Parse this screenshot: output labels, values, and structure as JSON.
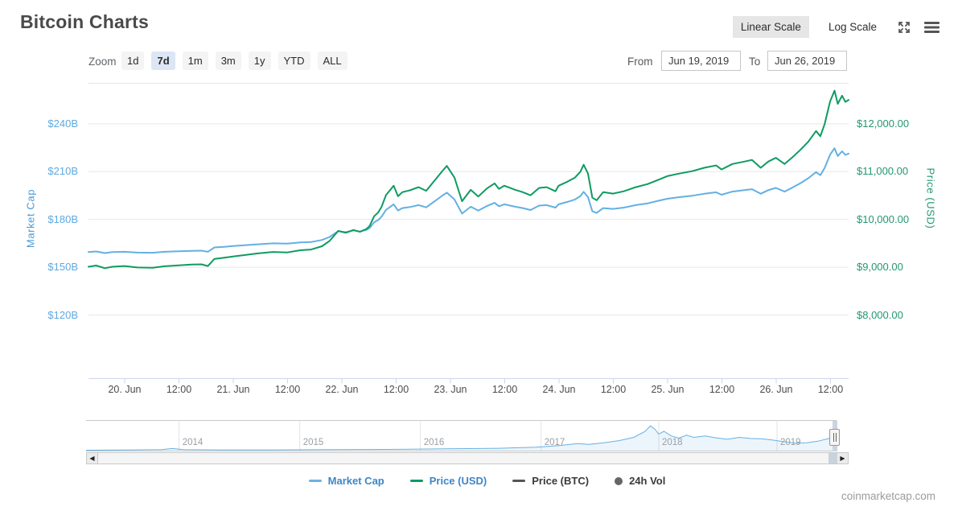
{
  "page": {
    "title": "Bitcoin Charts",
    "watermark": "coinmarketcap.com"
  },
  "scale_toggle": {
    "linear": "Linear Scale",
    "log": "Log Scale",
    "active": "Linear Scale"
  },
  "toolbar": {
    "zoom_label": "Zoom",
    "ranges": [
      "1d",
      "7d",
      "1m",
      "3m",
      "1y",
      "YTD",
      "ALL"
    ],
    "active_range": "7d",
    "from_label": "From",
    "from_value": "Jun 19, 2019",
    "to_label": "To",
    "to_value": "Jun 26, 2019"
  },
  "chart_data": {
    "type": "line",
    "title": "Bitcoin Charts",
    "x_axis": {
      "start": "Jun 19, 2019 16:00",
      "end": "Jun 26, 2019 16:00",
      "tick_labels": [
        "20. Jun",
        "12:00",
        "21. Jun",
        "12:00",
        "22. Jun",
        "12:00",
        "23. Jun",
        "12:00",
        "24. Jun",
        "12:00",
        "25. Jun",
        "12:00",
        "26. Jun",
        "12:00"
      ]
    },
    "left_axis": {
      "title": "Market Cap",
      "unit": "USD billions",
      "ticks": [
        "$240B",
        "$210B",
        "$180B",
        "$150B",
        "$120B"
      ],
      "values": [
        240,
        210,
        180,
        150,
        120
      ],
      "range": [
        120,
        240
      ]
    },
    "right_axis": {
      "title": "Price (USD)",
      "unit": "USD",
      "ticks": [
        "$12,000.00",
        "$11,000.00",
        "$10,000.00",
        "$9,000.00",
        "$8,000.00"
      ],
      "values": [
        12000,
        11000,
        10000,
        9000,
        8000
      ],
      "range": [
        8000,
        12000
      ]
    },
    "series": [
      {
        "name": "Market Cap",
        "axis": "left",
        "color": "#63b0e3",
        "unit": "$B",
        "points": [
          [
            0,
            159.5
          ],
          [
            0.07,
            159.9
          ],
          [
            0.15,
            158.9
          ],
          [
            0.22,
            159.5
          ],
          [
            0.33,
            159.7
          ],
          [
            0.45,
            159.2
          ],
          [
            0.59,
            159.1
          ],
          [
            0.7,
            159.7
          ],
          [
            0.83,
            160.0
          ],
          [
            0.95,
            160.3
          ],
          [
            1.04,
            160.4
          ],
          [
            1.1,
            159.7
          ],
          [
            1.16,
            162.4
          ],
          [
            1.25,
            162.8
          ],
          [
            1.33,
            163.3
          ],
          [
            1.45,
            163.9
          ],
          [
            1.56,
            164.4
          ],
          [
            1.7,
            165.0
          ],
          [
            1.83,
            164.8
          ],
          [
            1.95,
            165.6
          ],
          [
            2.05,
            165.8
          ],
          [
            2.15,
            167.1
          ],
          [
            2.22,
            169.0
          ],
          [
            2.3,
            172.7
          ],
          [
            2.37,
            172.0
          ],
          [
            2.44,
            173.1
          ],
          [
            2.5,
            172.4
          ],
          [
            2.56,
            173.5
          ],
          [
            2.59,
            174.6
          ],
          [
            2.63,
            178.2
          ],
          [
            2.67,
            179.7
          ],
          [
            2.7,
            181.8
          ],
          [
            2.74,
            186.0
          ],
          [
            2.78,
            188.0
          ],
          [
            2.81,
            189.5
          ],
          [
            2.85,
            185.6
          ],
          [
            2.89,
            187.1
          ],
          [
            2.96,
            187.8
          ],
          [
            3.04,
            189.0
          ],
          [
            3.11,
            187.6
          ],
          [
            3.19,
            191.5
          ],
          [
            3.26,
            195.0
          ],
          [
            3.3,
            196.8
          ],
          [
            3.37,
            192.5
          ],
          [
            3.44,
            183.7
          ],
          [
            3.52,
            188.0
          ],
          [
            3.59,
            185.5
          ],
          [
            3.67,
            188.5
          ],
          [
            3.74,
            190.4
          ],
          [
            3.78,
            188.3
          ],
          [
            3.83,
            189.5
          ],
          [
            3.93,
            188.0
          ],
          [
            4.0,
            187.1
          ],
          [
            4.07,
            185.9
          ],
          [
            4.15,
            188.7
          ],
          [
            4.22,
            189.0
          ],
          [
            4.3,
            187.4
          ],
          [
            4.33,
            189.5
          ],
          [
            4.41,
            191.0
          ],
          [
            4.48,
            192.5
          ],
          [
            4.53,
            194.7
          ],
          [
            4.56,
            197.3
          ],
          [
            4.6,
            194.0
          ],
          [
            4.64,
            185.1
          ],
          [
            4.68,
            184.1
          ],
          [
            4.74,
            187.1
          ],
          [
            4.83,
            186.6
          ],
          [
            4.93,
            187.4
          ],
          [
            5.04,
            189.0
          ],
          [
            5.15,
            190.1
          ],
          [
            5.26,
            191.9
          ],
          [
            5.33,
            193.0
          ],
          [
            5.44,
            194.0
          ],
          [
            5.56,
            194.9
          ],
          [
            5.67,
            196.1
          ],
          [
            5.78,
            197.0
          ],
          [
            5.83,
            195.5
          ],
          [
            5.93,
            197.5
          ],
          [
            6.04,
            198.4
          ],
          [
            6.11,
            199.0
          ],
          [
            6.19,
            196.1
          ],
          [
            6.26,
            198.4
          ],
          [
            6.33,
            199.8
          ],
          [
            6.41,
            197.5
          ],
          [
            6.48,
            199.9
          ],
          [
            6.56,
            202.9
          ],
          [
            6.63,
            205.9
          ],
          [
            6.7,
            209.7
          ],
          [
            6.74,
            207.8
          ],
          [
            6.78,
            212.4
          ],
          [
            6.83,
            220.7
          ],
          [
            6.87,
            224.7
          ],
          [
            6.9,
            219.8
          ],
          [
            6.94,
            222.8
          ],
          [
            6.97,
            220.5
          ],
          [
            7.0,
            221.3
          ]
        ]
      },
      {
        "name": "Price (USD)",
        "axis": "right",
        "color": "#0f9b62",
        "unit": "$",
        "points": [
          [
            0,
            9010
          ],
          [
            0.07,
            9035
          ],
          [
            0.15,
            8980
          ],
          [
            0.22,
            9010
          ],
          [
            0.33,
            9025
          ],
          [
            0.45,
            8995
          ],
          [
            0.59,
            8990
          ],
          [
            0.7,
            9020
          ],
          [
            0.83,
            9040
          ],
          [
            0.95,
            9055
          ],
          [
            1.04,
            9060
          ],
          [
            1.1,
            9025
          ],
          [
            1.16,
            9175
          ],
          [
            1.25,
            9200
          ],
          [
            1.33,
            9225
          ],
          [
            1.45,
            9260
          ],
          [
            1.56,
            9290
          ],
          [
            1.7,
            9320
          ],
          [
            1.83,
            9310
          ],
          [
            1.95,
            9355
          ],
          [
            2.05,
            9370
          ],
          [
            2.15,
            9440
          ],
          [
            2.22,
            9550
          ],
          [
            2.3,
            9760
          ],
          [
            2.37,
            9720
          ],
          [
            2.44,
            9780
          ],
          [
            2.5,
            9740
          ],
          [
            2.56,
            9800
          ],
          [
            2.59,
            9865
          ],
          [
            2.63,
            10065
          ],
          [
            2.67,
            10150
          ],
          [
            2.7,
            10270
          ],
          [
            2.74,
            10510
          ],
          [
            2.78,
            10620
          ],
          [
            2.81,
            10705
          ],
          [
            2.85,
            10485
          ],
          [
            2.89,
            10570
          ],
          [
            2.96,
            10610
          ],
          [
            3.04,
            10675
          ],
          [
            3.11,
            10600
          ],
          [
            3.19,
            10820
          ],
          [
            3.26,
            11015
          ],
          [
            3.3,
            11120
          ],
          [
            3.37,
            10875
          ],
          [
            3.44,
            10380
          ],
          [
            3.52,
            10620
          ],
          [
            3.59,
            10480
          ],
          [
            3.67,
            10650
          ],
          [
            3.74,
            10755
          ],
          [
            3.78,
            10640
          ],
          [
            3.83,
            10705
          ],
          [
            3.93,
            10620
          ],
          [
            4.0,
            10570
          ],
          [
            4.07,
            10505
          ],
          [
            4.15,
            10660
          ],
          [
            4.22,
            10675
          ],
          [
            4.3,
            10590
          ],
          [
            4.33,
            10705
          ],
          [
            4.41,
            10790
          ],
          [
            4.48,
            10875
          ],
          [
            4.53,
            11000
          ],
          [
            4.56,
            11145
          ],
          [
            4.6,
            10960
          ],
          [
            4.64,
            10455
          ],
          [
            4.68,
            10400
          ],
          [
            4.74,
            10570
          ],
          [
            4.83,
            10540
          ],
          [
            4.93,
            10590
          ],
          [
            5.04,
            10675
          ],
          [
            5.15,
            10740
          ],
          [
            5.26,
            10840
          ],
          [
            5.33,
            10905
          ],
          [
            5.44,
            10960
          ],
          [
            5.56,
            11010
          ],
          [
            5.67,
            11080
          ],
          [
            5.78,
            11130
          ],
          [
            5.83,
            11045
          ],
          [
            5.93,
            11160
          ],
          [
            6.04,
            11210
          ],
          [
            6.11,
            11245
          ],
          [
            6.19,
            11080
          ],
          [
            6.26,
            11210
          ],
          [
            6.33,
            11290
          ],
          [
            6.41,
            11160
          ],
          [
            6.48,
            11295
          ],
          [
            6.56,
            11465
          ],
          [
            6.63,
            11630
          ],
          [
            6.7,
            11850
          ],
          [
            6.74,
            11740
          ],
          [
            6.78,
            12000
          ],
          [
            6.83,
            12470
          ],
          [
            6.87,
            12695
          ],
          [
            6.9,
            12420
          ],
          [
            6.94,
            12590
          ],
          [
            6.97,
            12460
          ],
          [
            7.0,
            12500
          ]
        ]
      }
    ],
    "navigator": {
      "year_labels": [
        "2014",
        "2015",
        "2016",
        "2017",
        "2018",
        "2019"
      ],
      "series_name": "Market Cap (all time)",
      "points": [
        [
          0,
          0.03
        ],
        [
          0.06,
          0.04
        ],
        [
          0.1,
          0.05
        ],
        [
          0.115,
          0.09
        ],
        [
          0.13,
          0.05
        ],
        [
          0.18,
          0.04
        ],
        [
          0.25,
          0.04
        ],
        [
          0.32,
          0.05
        ],
        [
          0.4,
          0.06
        ],
        [
          0.48,
          0.08
        ],
        [
          0.55,
          0.1
        ],
        [
          0.6,
          0.14
        ],
        [
          0.63,
          0.2
        ],
        [
          0.655,
          0.27
        ],
        [
          0.67,
          0.24
        ],
        [
          0.69,
          0.3
        ],
        [
          0.71,
          0.38
        ],
        [
          0.73,
          0.5
        ],
        [
          0.745,
          0.72
        ],
        [
          0.752,
          0.92
        ],
        [
          0.758,
          0.8
        ],
        [
          0.763,
          0.62
        ],
        [
          0.77,
          0.72
        ],
        [
          0.78,
          0.55
        ],
        [
          0.79,
          0.47
        ],
        [
          0.8,
          0.58
        ],
        [
          0.81,
          0.5
        ],
        [
          0.825,
          0.55
        ],
        [
          0.84,
          0.48
        ],
        [
          0.855,
          0.43
        ],
        [
          0.87,
          0.5
        ],
        [
          0.885,
          0.46
        ],
        [
          0.9,
          0.45
        ],
        [
          0.915,
          0.4
        ],
        [
          0.93,
          0.34
        ],
        [
          0.945,
          0.29
        ],
        [
          0.96,
          0.3
        ],
        [
          0.975,
          0.36
        ],
        [
          0.99,
          0.46
        ],
        [
          1.0,
          0.52
        ]
      ]
    },
    "legend": [
      {
        "label": "Market Cap",
        "color": "#6ab2e4",
        "type": "line",
        "active": true
      },
      {
        "label": "Price (USD)",
        "color": "#0f9b62",
        "type": "line",
        "active": true
      },
      {
        "label": "Price (BTC)",
        "color": "#555555",
        "type": "line",
        "active": false
      },
      {
        "label": "24h Vol",
        "color": "#666666",
        "type": "circle",
        "active": false
      }
    ],
    "colors": {
      "grid": "#e7e7e7",
      "axis_line": "#ccd6eb",
      "left_tick_text": "#5da9e0",
      "right_tick_text": "#23986e"
    }
  }
}
